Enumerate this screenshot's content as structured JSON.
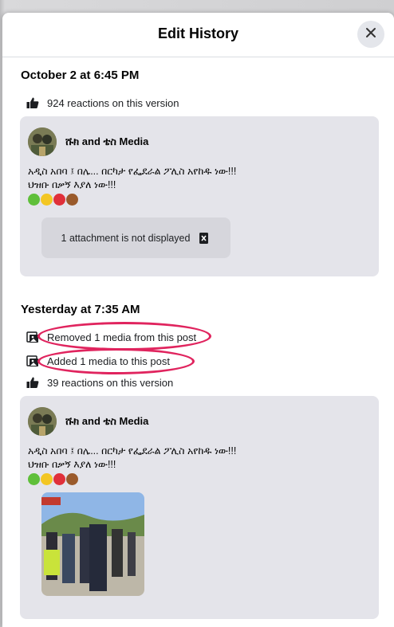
{
  "dialog": {
    "title": "Edit History"
  },
  "versions": [
    {
      "date": "October 2 at 6:45 PM",
      "reactions": "924 reactions on this version",
      "author": "ሹክ and ቴስ Media",
      "text_line1": "አዲስ አበባ ፤ በሌ... በርካታ የፌደራል ፖሊስ አየከዱ ነው!!!",
      "text_line2": "ህዝቡ በቃኝ እያለ ነው!!!",
      "attachment_note": "1 attachment is not displayed"
    },
    {
      "date": "Yesterday at 7:35 AM",
      "changes": [
        "Removed 1 media from this post",
        "Added 1 media to this post"
      ],
      "reactions": "39 reactions on this version",
      "author": "ሹክ and ቴስ Media",
      "text_line1": "አዲስ አበባ ፤ በሌ... በርካታ የፌደራል ፖሊስ አየከዱ ነው!!!",
      "text_line2": "ህዝቡ በቃኝ እያለ ነው!!!"
    }
  ],
  "icons": [
    "close-icon",
    "thumbs-up-icon",
    "media-removed-icon",
    "media-added-icon",
    "hidden-attachment-icon"
  ],
  "colors": {
    "card_bg": "#e4e4ea",
    "highlight": "#e0245e",
    "emoji_green": "#5fbf3a",
    "emoji_yellow": "#f3c623",
    "emoji_red": "#e0303a",
    "emoji_fist": "#9a5a2b"
  }
}
